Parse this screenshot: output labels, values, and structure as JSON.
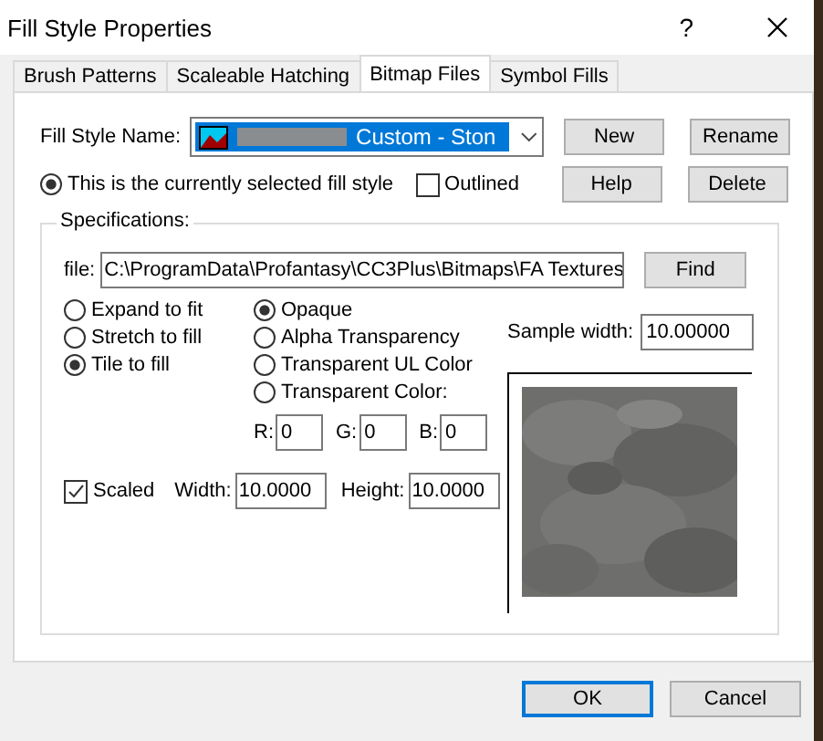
{
  "window": {
    "title": "Fill Style Properties",
    "help": "?"
  },
  "tabs": [
    {
      "label": "Brush Patterns",
      "selected": false
    },
    {
      "label": "Scaleable Hatching",
      "selected": false
    },
    {
      "label": "Bitmap Files",
      "selected": true
    },
    {
      "label": "Symbol Fills",
      "selected": false
    }
  ],
  "fill_style_name": {
    "label": "Fill Style Name:",
    "value": "Custom - Ston"
  },
  "side_buttons": [
    "New",
    "Rename",
    "Help",
    "Delete"
  ],
  "current_style": {
    "label": "This is the currently selected fill style",
    "selected": true
  },
  "outlined": {
    "label": "Outlined",
    "checked": false
  },
  "specifications": {
    "label": "Specifications:",
    "file_label": "file:",
    "file_value": "C:\\ProgramData\\Profantasy\\CC3Plus\\Bitmaps\\FA Textures",
    "find": "Find",
    "fit_options": [
      {
        "label": "Expand to fit",
        "selected": false
      },
      {
        "label": "Stretch to fill",
        "selected": false
      },
      {
        "label": "Tile to fill",
        "selected": true
      }
    ],
    "transparency_options": [
      {
        "label": "Opaque",
        "selected": true
      },
      {
        "label": "Alpha Transparency",
        "selected": false
      },
      {
        "label": "Transparent UL Color",
        "selected": false
      },
      {
        "label": "Transparent Color:",
        "selected": false
      }
    ],
    "color_fields": [
      {
        "label": "R:",
        "value": "0"
      },
      {
        "label": "G:",
        "value": "0"
      },
      {
        "label": "B:",
        "value": "0"
      }
    ],
    "sample_width": {
      "label": "Sample width:",
      "value": "10.00000"
    },
    "scaled": {
      "label": "Scaled",
      "checked": true
    },
    "width": {
      "label": "Width:",
      "value": "10.0000"
    },
    "height": {
      "label": "Height:",
      "value": "10.0000"
    }
  },
  "dialog_buttons": [
    {
      "label": "OK",
      "default": true
    },
    {
      "label": "Cancel",
      "default": false
    }
  ]
}
